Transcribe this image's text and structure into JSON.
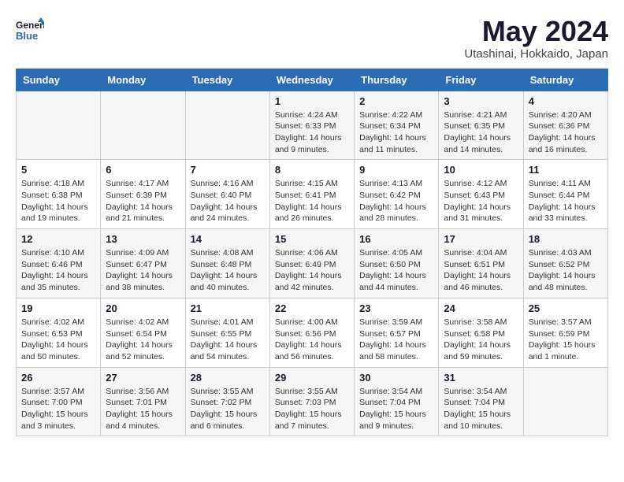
{
  "header": {
    "logo_line1": "General",
    "logo_line2": "Blue",
    "month_title": "May 2024",
    "location": "Utashinai, Hokkaido, Japan"
  },
  "weekdays": [
    "Sunday",
    "Monday",
    "Tuesday",
    "Wednesday",
    "Thursday",
    "Friday",
    "Saturday"
  ],
  "weeks": [
    [
      {
        "day": "",
        "info": ""
      },
      {
        "day": "",
        "info": ""
      },
      {
        "day": "",
        "info": ""
      },
      {
        "day": "1",
        "info": "Sunrise: 4:24 AM\nSunset: 6:33 PM\nDaylight: 14 hours\nand 9 minutes."
      },
      {
        "day": "2",
        "info": "Sunrise: 4:22 AM\nSunset: 6:34 PM\nDaylight: 14 hours\nand 11 minutes."
      },
      {
        "day": "3",
        "info": "Sunrise: 4:21 AM\nSunset: 6:35 PM\nDaylight: 14 hours\nand 14 minutes."
      },
      {
        "day": "4",
        "info": "Sunrise: 4:20 AM\nSunset: 6:36 PM\nDaylight: 14 hours\nand 16 minutes."
      }
    ],
    [
      {
        "day": "5",
        "info": "Sunrise: 4:18 AM\nSunset: 6:38 PM\nDaylight: 14 hours\nand 19 minutes."
      },
      {
        "day": "6",
        "info": "Sunrise: 4:17 AM\nSunset: 6:39 PM\nDaylight: 14 hours\nand 21 minutes."
      },
      {
        "day": "7",
        "info": "Sunrise: 4:16 AM\nSunset: 6:40 PM\nDaylight: 14 hours\nand 24 minutes."
      },
      {
        "day": "8",
        "info": "Sunrise: 4:15 AM\nSunset: 6:41 PM\nDaylight: 14 hours\nand 26 minutes."
      },
      {
        "day": "9",
        "info": "Sunrise: 4:13 AM\nSunset: 6:42 PM\nDaylight: 14 hours\nand 28 minutes."
      },
      {
        "day": "10",
        "info": "Sunrise: 4:12 AM\nSunset: 6:43 PM\nDaylight: 14 hours\nand 31 minutes."
      },
      {
        "day": "11",
        "info": "Sunrise: 4:11 AM\nSunset: 6:44 PM\nDaylight: 14 hours\nand 33 minutes."
      }
    ],
    [
      {
        "day": "12",
        "info": "Sunrise: 4:10 AM\nSunset: 6:46 PM\nDaylight: 14 hours\nand 35 minutes."
      },
      {
        "day": "13",
        "info": "Sunrise: 4:09 AM\nSunset: 6:47 PM\nDaylight: 14 hours\nand 38 minutes."
      },
      {
        "day": "14",
        "info": "Sunrise: 4:08 AM\nSunset: 6:48 PM\nDaylight: 14 hours\nand 40 minutes."
      },
      {
        "day": "15",
        "info": "Sunrise: 4:06 AM\nSunset: 6:49 PM\nDaylight: 14 hours\nand 42 minutes."
      },
      {
        "day": "16",
        "info": "Sunrise: 4:05 AM\nSunset: 6:50 PM\nDaylight: 14 hours\nand 44 minutes."
      },
      {
        "day": "17",
        "info": "Sunrise: 4:04 AM\nSunset: 6:51 PM\nDaylight: 14 hours\nand 46 minutes."
      },
      {
        "day": "18",
        "info": "Sunrise: 4:03 AM\nSunset: 6:52 PM\nDaylight: 14 hours\nand 48 minutes."
      }
    ],
    [
      {
        "day": "19",
        "info": "Sunrise: 4:02 AM\nSunset: 6:53 PM\nDaylight: 14 hours\nand 50 minutes."
      },
      {
        "day": "20",
        "info": "Sunrise: 4:02 AM\nSunset: 6:54 PM\nDaylight: 14 hours\nand 52 minutes."
      },
      {
        "day": "21",
        "info": "Sunrise: 4:01 AM\nSunset: 6:55 PM\nDaylight: 14 hours\nand 54 minutes."
      },
      {
        "day": "22",
        "info": "Sunrise: 4:00 AM\nSunset: 6:56 PM\nDaylight: 14 hours\nand 56 minutes."
      },
      {
        "day": "23",
        "info": "Sunrise: 3:59 AM\nSunset: 6:57 PM\nDaylight: 14 hours\nand 58 minutes."
      },
      {
        "day": "24",
        "info": "Sunrise: 3:58 AM\nSunset: 6:58 PM\nDaylight: 14 hours\nand 59 minutes."
      },
      {
        "day": "25",
        "info": "Sunrise: 3:57 AM\nSunset: 6:59 PM\nDaylight: 15 hours\nand 1 minute."
      }
    ],
    [
      {
        "day": "26",
        "info": "Sunrise: 3:57 AM\nSunset: 7:00 PM\nDaylight: 15 hours\nand 3 minutes."
      },
      {
        "day": "27",
        "info": "Sunrise: 3:56 AM\nSunset: 7:01 PM\nDaylight: 15 hours\nand 4 minutes."
      },
      {
        "day": "28",
        "info": "Sunrise: 3:55 AM\nSunset: 7:02 PM\nDaylight: 15 hours\nand 6 minutes."
      },
      {
        "day": "29",
        "info": "Sunrise: 3:55 AM\nSunset: 7:03 PM\nDaylight: 15 hours\nand 7 minutes."
      },
      {
        "day": "30",
        "info": "Sunrise: 3:54 AM\nSunset: 7:04 PM\nDaylight: 15 hours\nand 9 minutes."
      },
      {
        "day": "31",
        "info": "Sunrise: 3:54 AM\nSunset: 7:04 PM\nDaylight: 15 hours\nand 10 minutes."
      },
      {
        "day": "",
        "info": ""
      }
    ]
  ]
}
